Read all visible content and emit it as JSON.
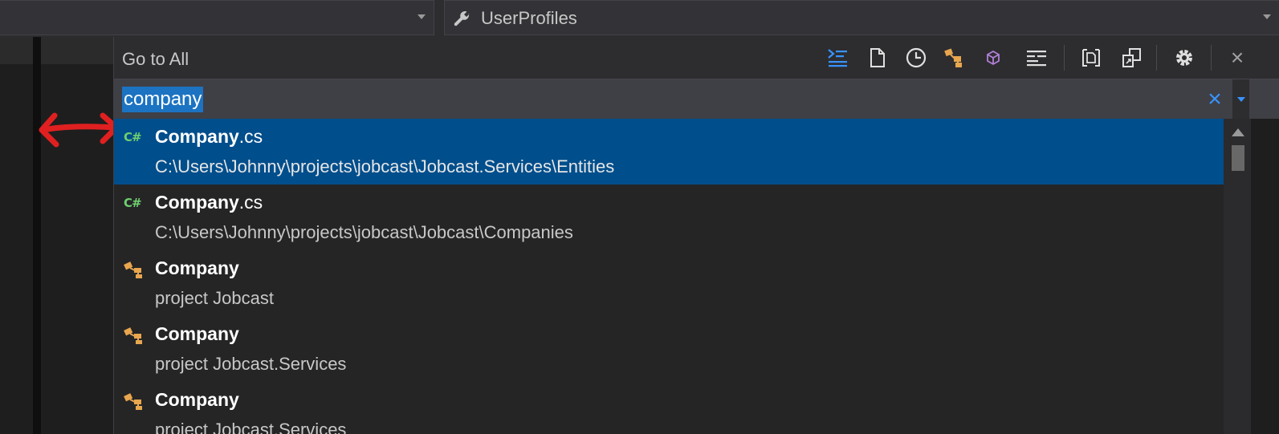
{
  "topbar": {
    "left_combo_value": "",
    "right_combo": {
      "icon": "wrench-icon",
      "label": "UserProfiles"
    }
  },
  "panel": {
    "title": "Go to All",
    "toolbar": [
      {
        "name": "lines-filter-icon"
      },
      {
        "name": "file-filter-icon"
      },
      {
        "name": "recent-files-icon"
      },
      {
        "name": "types-filter-icon"
      },
      {
        "name": "symbols-filter-icon"
      },
      {
        "name": "members-filter-icon"
      },
      {
        "name": "current-document-icon"
      },
      {
        "name": "external-items-icon"
      },
      {
        "name": "settings-icon"
      }
    ],
    "close_label": "×"
  },
  "search": {
    "value": "company",
    "clear_label": "×"
  },
  "results": [
    {
      "icon": "csharp-file-icon",
      "match": "Company",
      "ext": ".cs",
      "detail": "C:\\Users\\Johnny\\projects\\jobcast\\Jobcast.Services\\Entities",
      "selected": true
    },
    {
      "icon": "csharp-file-icon",
      "match": "Company",
      "ext": ".cs",
      "detail": "C:\\Users\\Johnny\\projects\\jobcast\\Jobcast\\Companies",
      "selected": false
    },
    {
      "icon": "class-icon",
      "match": "Company",
      "ext": "",
      "detail": "project Jobcast",
      "selected": false
    },
    {
      "icon": "class-icon",
      "match": "Company",
      "ext": "",
      "detail": "project Jobcast.Services",
      "selected": false
    },
    {
      "icon": "class-icon",
      "match": "Company",
      "ext": "",
      "detail": "project Jobcast.Services",
      "selected": false
    }
  ],
  "csharp_icon_text": "C#",
  "colors": {
    "selection": "#004e8c",
    "accent": "#3794ff",
    "annotation_arrow": "#e02020"
  }
}
